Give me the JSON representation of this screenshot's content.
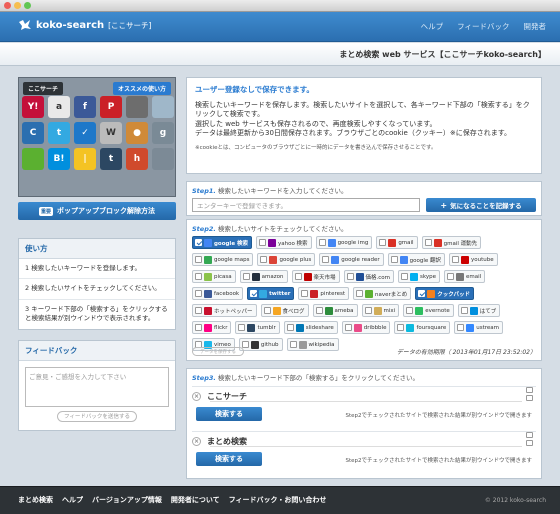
{
  "header": {
    "logo_text": "koko-search",
    "logo_sub": "[ここサーチ]",
    "nav": [
      "ヘルプ",
      "フィードバック",
      "開発者"
    ]
  },
  "subheader": {
    "title": "まとめ検索 web サービス【ここサーチkoko-search】"
  },
  "promo": {
    "tab_left": "ここサーチ",
    "tab_right": "オススメの使い方",
    "tiles": [
      {
        "label": "Y!",
        "color": "#c4103a"
      },
      {
        "label": "a",
        "color": "#e9e9e9"
      },
      {
        "label": "f",
        "color": "#3b5998"
      },
      {
        "label": "P",
        "color": "#cb2027"
      },
      {
        "label": "",
        "color": "#6d6d6d"
      },
      {
        "label": "",
        "color": "#9fb7c9"
      },
      {
        "label": "C",
        "color": "#2b6fb0"
      },
      {
        "label": "t",
        "color": "#33a9e1"
      },
      {
        "label": "✓",
        "color": "#1e78c9"
      },
      {
        "label": "W",
        "color": "#bbbbbb"
      },
      {
        "label": "●",
        "color": "#d08a38"
      },
      {
        "label": "g",
        "color": "#7a8a96"
      },
      {
        "label": "",
        "color": "#5bb030"
      },
      {
        "label": "B!",
        "color": "#008fde"
      },
      {
        "label": "|",
        "color": "#f4c323"
      },
      {
        "label": "t",
        "color": "#2c4762"
      },
      {
        "label": "h",
        "color": "#d04a2c"
      },
      {
        "label": "",
        "color": "#7c8a96"
      }
    ]
  },
  "popup_button": {
    "badge": "重要",
    "label": "ポップアップブロック解除方法"
  },
  "usage": {
    "title": "使い方",
    "items": [
      "1 検索したいキーワードを登録します。",
      "2 検索したいサイトをチェックしてください。",
      "3 キーワード下部の「検索する」をクリックすると検索結果が別ウインドウで表示されます。"
    ]
  },
  "feedback": {
    "title": "フィードバック",
    "placeholder": "ご意見・ご感想を入力して下さい",
    "button": "フィードバックを送信する"
  },
  "intro": {
    "title": "ユーザー登録なしで保存できます。",
    "lines": [
      "検索したいキーワードを保存します。検索したいサイトを選択して、各キーワード下部の「検索する」をクリックして検索です。",
      "選択した web サービスも保存されるので、再度検索しやすくなっています。",
      "データは最終更新から30日間保存されます。ブラウザごとのcookie（クッキー）※に保存されます。"
    ],
    "note": "※cookieとは、コンピュータのブラウザごとに一時的にデータを書き込んで保存させることです。"
  },
  "step1": {
    "num": "Step1.",
    "text": "検索したいキーワードを入力してください。",
    "placeholder": "エンターキーで登録できます。",
    "button": "気になることを記録する"
  },
  "step2": {
    "num": "Step2.",
    "text": "検索したいサイトをチェックしてください。",
    "sites": [
      {
        "name": "google 検索",
        "on": true,
        "color": "#4285f4"
      },
      {
        "name": "yahoo 検索",
        "on": false,
        "color": "#7b0099"
      },
      {
        "name": "google img",
        "on": false,
        "color": "#4285f4"
      },
      {
        "name": "gmail",
        "on": false,
        "color": "#d93025"
      },
      {
        "name": "gmail 運動先",
        "on": false,
        "color": "#d93025"
      },
      {
        "name": "google maps",
        "on": false,
        "color": "#34a853"
      },
      {
        "name": "google plus",
        "on": false,
        "color": "#db4437"
      },
      {
        "name": "google reader",
        "on": false,
        "color": "#4285f4"
      },
      {
        "name": "google 翻訳",
        "on": false,
        "color": "#4285f4"
      },
      {
        "name": "youtube",
        "on": false,
        "color": "#cc0000"
      },
      {
        "name": "picasa",
        "on": false,
        "color": "#8bc34a"
      },
      {
        "name": "amazon",
        "on": false,
        "color": "#232f3e"
      },
      {
        "name": "楽天市場",
        "on": false,
        "color": "#bf0000"
      },
      {
        "name": "価格.com",
        "on": false,
        "color": "#1f4e96"
      },
      {
        "name": "skype",
        "on": false,
        "color": "#00aff0"
      },
      {
        "name": "email",
        "on": false,
        "color": "#777777"
      },
      {
        "name": "facebook",
        "on": false,
        "color": "#3b5998"
      },
      {
        "name": "twitter",
        "on": true,
        "color": "#33a9e1"
      },
      {
        "name": "pinterest",
        "on": false,
        "color": "#cb2027"
      },
      {
        "name": "naverまとめ",
        "on": false,
        "color": "#5bb030"
      },
      {
        "name": "クックパッド",
        "on": true,
        "color": "#f48120"
      },
      {
        "name": "ホットペッパー",
        "on": false,
        "color": "#c8102e"
      },
      {
        "name": "食べログ",
        "on": false,
        "color": "#f5a623"
      },
      {
        "name": "ameba",
        "on": false,
        "color": "#2d8c3c"
      },
      {
        "name": "mixi",
        "on": false,
        "color": "#d1ad59"
      },
      {
        "name": "evernote",
        "on": false,
        "color": "#2dbe60"
      },
      {
        "name": "はてブ",
        "on": false,
        "color": "#008fde"
      },
      {
        "name": "flickr",
        "on": false,
        "color": "#ff0084"
      },
      {
        "name": "tumblr",
        "on": false,
        "color": "#2c4762"
      },
      {
        "name": "slideshare",
        "on": false,
        "color": "#0077b5"
      },
      {
        "name": "dribbble",
        "on": false,
        "color": "#ea4c89"
      },
      {
        "name": "foursquare",
        "on": false,
        "color": "#0cbadf"
      },
      {
        "name": "ustream",
        "on": false,
        "color": "#3388ff"
      },
      {
        "name": "vimeo",
        "on": false,
        "color": "#1ab7ea"
      },
      {
        "name": "github",
        "on": false,
        "color": "#333333"
      },
      {
        "name": "wikipedia",
        "on": false,
        "color": "#999999"
      }
    ],
    "save_button": "データを保存する",
    "expiry": "データの有効期限（ 2013年01月17日 23:52:02）"
  },
  "step3": {
    "num": "Step3.",
    "text": "検索したいキーワード下部の「検索する」をクリックしてください。",
    "keywords": [
      {
        "title": "ここサーチ",
        "button": "検索する",
        "note": "Step2でチェックされたサイトで検索された結果が別ウインドウで開きます"
      },
      {
        "title": "まとめ検索",
        "button": "検索する",
        "note": "Step2でチェックされたサイトで検索された結果が別ウインドウで開きます"
      }
    ]
  },
  "footer": {
    "links": [
      "まとめ検索",
      "ヘルプ",
      "バージョンアップ情報",
      "開発者について",
      "フィードバック・お問い合わせ"
    ],
    "copyright": "© 2012 koko-search"
  }
}
